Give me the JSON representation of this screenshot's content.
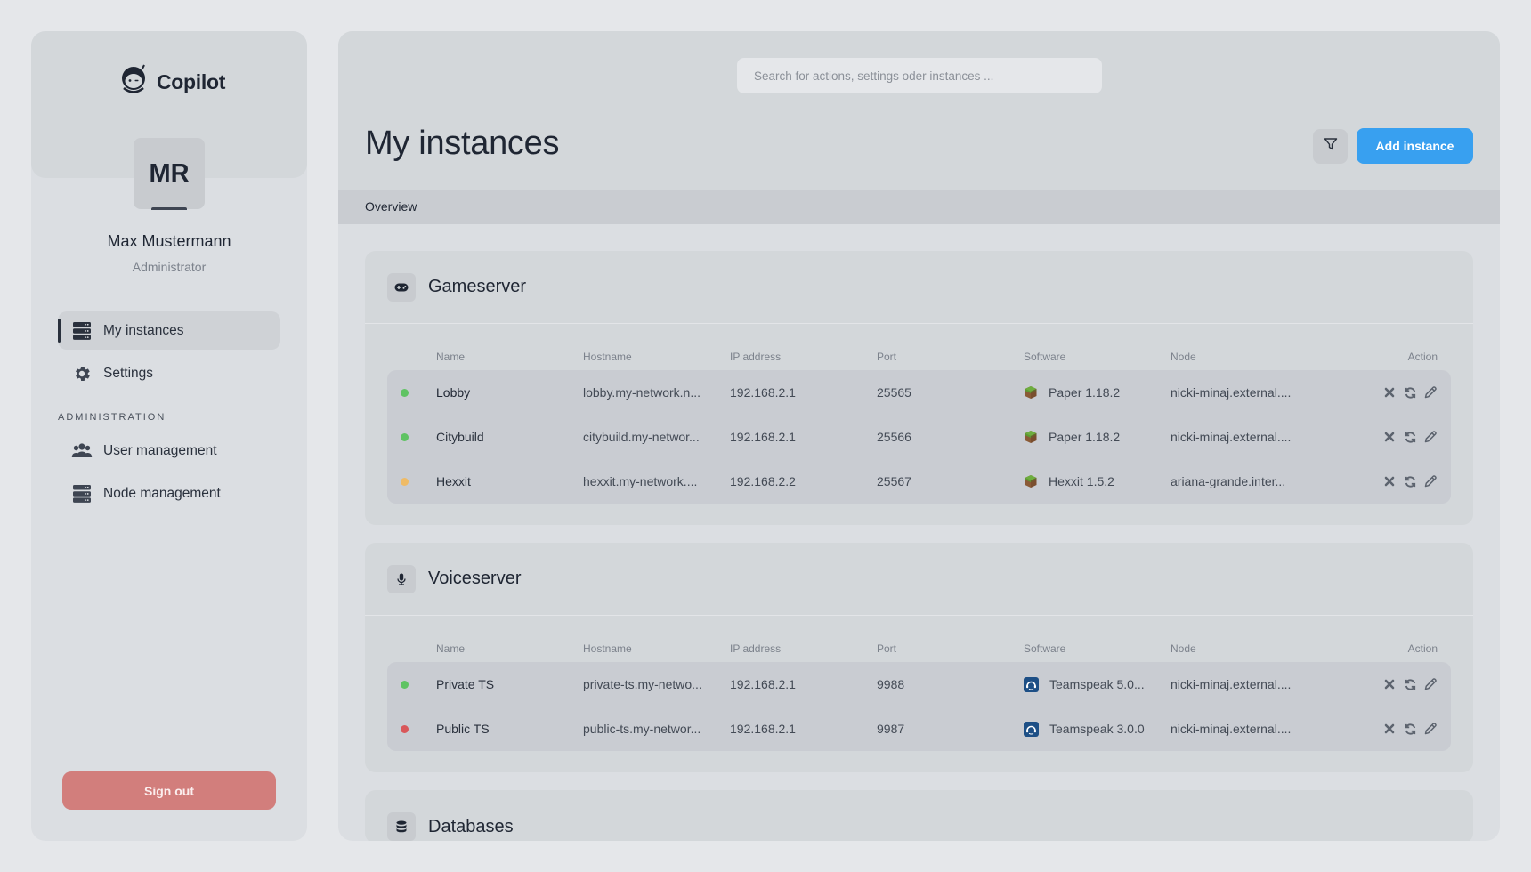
{
  "app": {
    "brand": "Copilot"
  },
  "user": {
    "initials": "MR",
    "name": "Max Mustermann",
    "role": "Administrator"
  },
  "sidebar": {
    "items": [
      {
        "label": "My instances",
        "icon": "server-stack-icon",
        "active": true
      },
      {
        "label": "Settings",
        "icon": "gear-icon",
        "active": false
      }
    ],
    "section_label": "ADMINISTRATION",
    "admin_items": [
      {
        "label": "User management",
        "icon": "users-icon"
      },
      {
        "label": "Node management",
        "icon": "server-stack-icon"
      }
    ],
    "sign_out_label": "Sign out"
  },
  "header": {
    "search_placeholder": "Search for actions, settings oder instances ...",
    "title": "My instances",
    "filter_icon": "filter-icon",
    "add_button_label": "Add instance",
    "tabs": [
      {
        "label": "Overview",
        "active": true
      }
    ]
  },
  "colors": {
    "accent": "#38a0f0",
    "danger": "#d27e7c",
    "status_online": "#5fc363",
    "status_starting": "#efbb66",
    "status_offline": "#d9575a"
  },
  "columns": [
    "Name",
    "Hostname",
    "IP address",
    "Port",
    "Software",
    "Node",
    "Action"
  ],
  "groups": [
    {
      "title": "Gameserver",
      "icon": "gamepad-icon",
      "rows": [
        {
          "status": "online",
          "name": "Lobby",
          "hostname": "lobby.my-network.n...",
          "ip": "192.168.2.1",
          "port": "25565",
          "software": "Paper 1.18.2",
          "software_icon": "minecraft-grass-block-icon",
          "node": "nicki-minaj.external...."
        },
        {
          "status": "online",
          "name": "Citybuild",
          "hostname": "citybuild.my-networ...",
          "ip": "192.168.2.1",
          "port": "25566",
          "software": "Paper 1.18.2",
          "software_icon": "minecraft-grass-block-icon",
          "node": "nicki-minaj.external...."
        },
        {
          "status": "starting",
          "name": "Hexxit",
          "hostname": "hexxit.my-network....",
          "ip": "192.168.2.2",
          "port": "25567",
          "software": "Hexxit 1.5.2",
          "software_icon": "minecraft-grass-block-icon",
          "node": "ariana-grande.inter..."
        }
      ]
    },
    {
      "title": "Voiceserver",
      "icon": "microphone-icon",
      "rows": [
        {
          "status": "online",
          "name": "Private TS",
          "hostname": "private-ts.my-netwo...",
          "ip": "192.168.2.1",
          "port": "9988",
          "software": "Teamspeak 5.0...",
          "software_icon": "teamspeak-icon",
          "node": "nicki-minaj.external...."
        },
        {
          "status": "offline",
          "name": "Public TS",
          "hostname": "public-ts.my-networ...",
          "ip": "192.168.2.1",
          "port": "9987",
          "software": "Teamspeak 3.0.0",
          "software_icon": "teamspeak-icon",
          "node": "nicki-minaj.external...."
        }
      ]
    },
    {
      "title": "Databases",
      "icon": "database-icon",
      "rows": []
    }
  ],
  "row_actions": [
    "stop-icon",
    "restart-icon",
    "edit-icon"
  ]
}
